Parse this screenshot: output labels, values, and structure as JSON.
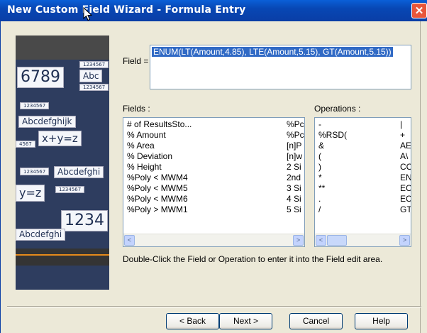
{
  "window": {
    "title": "New Custom Field Wizard - Formula Entry",
    "close_glyph": "✕"
  },
  "banner": {
    "texts": [
      "1234567",
      "6789",
      "Abc",
      "1234567",
      "1234567",
      "Abcdefghijk",
      "x+y=z",
      "4567",
      "1234567",
      "Abcdefghi",
      "y=z",
      "1234567",
      "1234",
      "Abcdefghi"
    ]
  },
  "field": {
    "label": "Field =",
    "value": "ENUM(LT(Amount,4.85), LTE(Amount,5.15), GT(Amount,5.15))"
  },
  "fields": {
    "label": "Fields :",
    "rows": [
      [
        "# of ResultsSto...",
        "%Pc"
      ],
      [
        "% Amount",
        "%Pc"
      ],
      [
        "% Area",
        "[n]P"
      ],
      [
        "% Deviation",
        "[n]w"
      ],
      [
        "% Height",
        "2 Si"
      ],
      [
        "%Poly < MWM4",
        "2nd"
      ],
      [
        "%Poly < MWM5",
        "3 Si"
      ],
      [
        "%Poly < MWM6",
        "4 Si"
      ],
      [
        "%Poly > MWM1",
        "5 Si"
      ]
    ]
  },
  "operations": {
    "label": "Operations :",
    "rows": [
      [
        "-",
        "|"
      ],
      [
        "%RSD(",
        "+"
      ],
      [
        "&",
        "AE"
      ],
      [
        "(",
        "A\\"
      ],
      [
        ")",
        "CC"
      ],
      [
        "*",
        "EN"
      ],
      [
        "**",
        "EC"
      ],
      [
        ".",
        "EC"
      ],
      [
        "/",
        "GT"
      ]
    ]
  },
  "scroll": {
    "left": "<",
    "right": ">"
  },
  "hint": "Double-Click the Field or Operation to enter it into the Field edit area.",
  "buttons": {
    "back": "< Back",
    "next": "Next >",
    "cancel": "Cancel",
    "help": "Help"
  }
}
